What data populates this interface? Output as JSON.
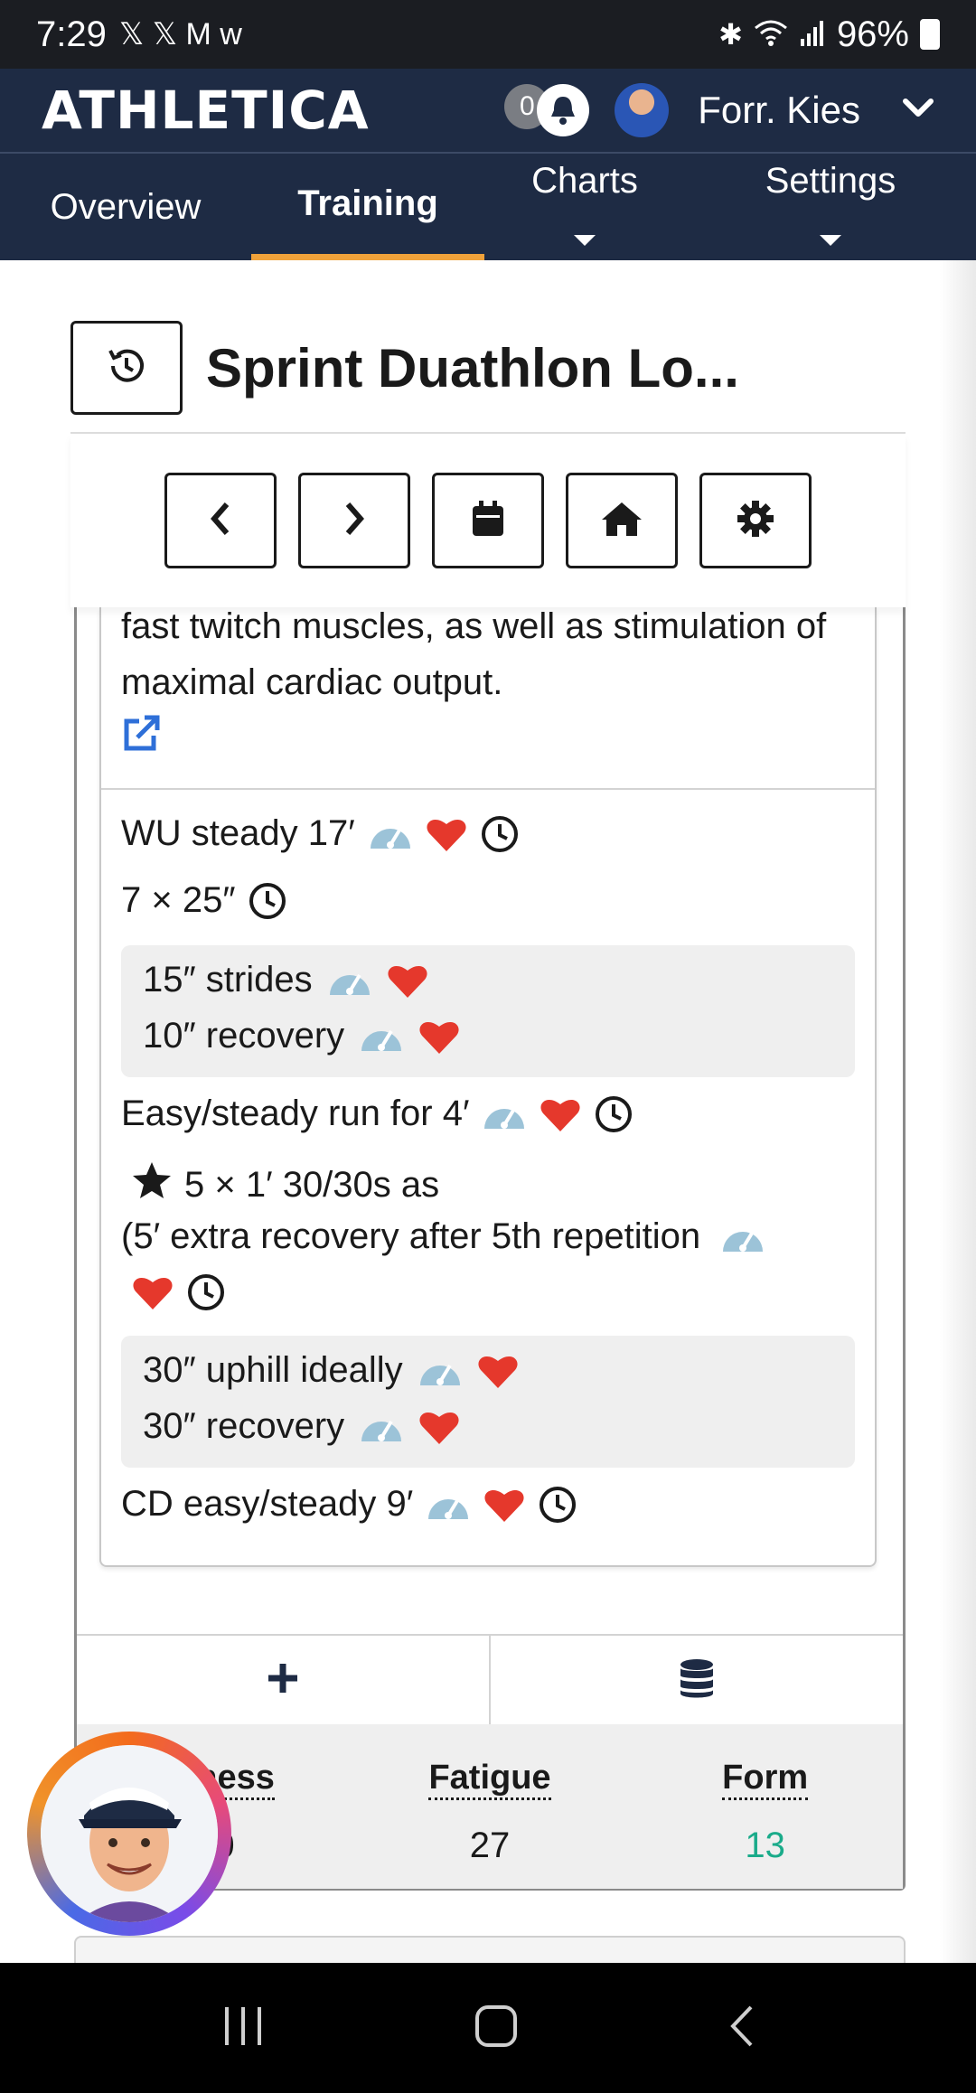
{
  "status_bar": {
    "time": "7:29",
    "notif_icons": "𝕏 𝕏 M w",
    "battery": "96%"
  },
  "header": {
    "logo": "ATHLETICA",
    "notif_count": "0",
    "user_name": "Forr. Kies"
  },
  "tabs": [
    {
      "label": "Overview"
    },
    {
      "label": "Training"
    },
    {
      "label": "Charts"
    },
    {
      "label": "Settings"
    }
  ],
  "workout": {
    "title": "Sprint Duathlon Lo...",
    "description": "fast twitch muscles, as well as stimulation of maximal cardiac output."
  },
  "steps": {
    "s1": "WU steady 17′",
    "s2": "7 × 25″",
    "s2a": "15″ strides",
    "s2b": "10″ recovery",
    "s3": "Easy/steady run for 4′",
    "s4": "5 × 1′ 30/30s as",
    "s4note": "(5′ extra recovery after 5th repetition",
    "s4a": "30″ uphill ideally",
    "s4b": "30″ recovery",
    "s5": "CD easy/steady 9′"
  },
  "stats": {
    "fitness_label": "Fitness",
    "fitness_value": "40",
    "fatigue_label": "Fatigue",
    "fatigue_value": "27",
    "form_label": "Form",
    "form_value": "13"
  },
  "colors": {
    "header_bg": "#1e2b44",
    "tab_active_underline": "#f0a23a",
    "heart": "#e5382c",
    "gauge": "#9cc3d8",
    "form_value": "#1aab8a",
    "link": "#2e6fd8"
  }
}
